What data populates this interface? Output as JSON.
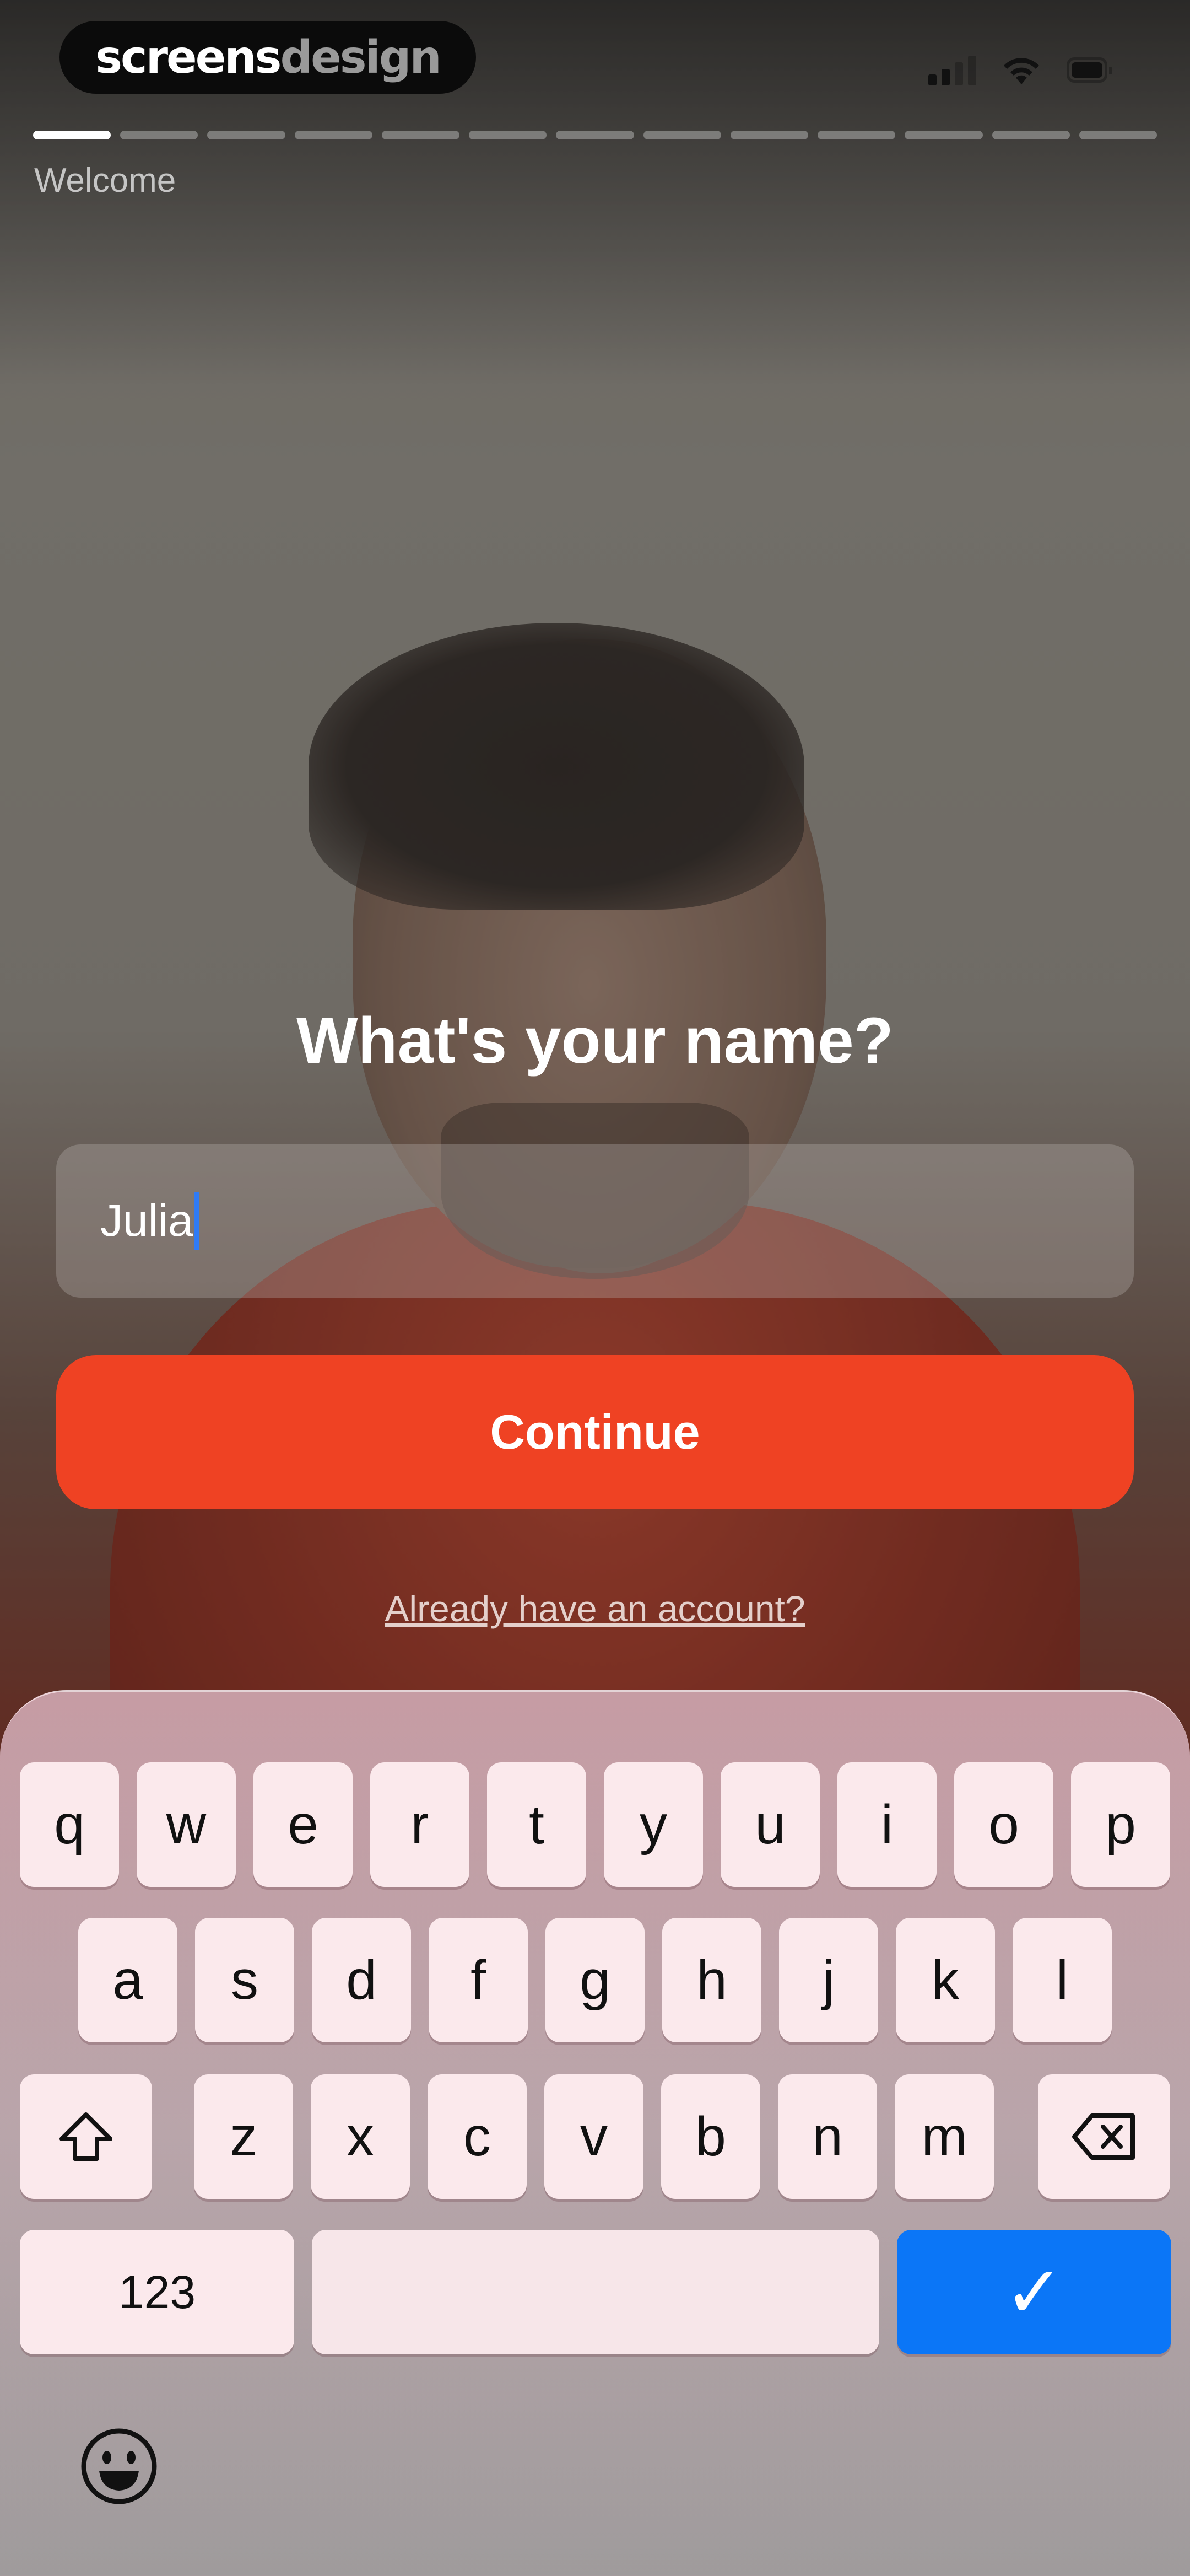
{
  "brand": {
    "part1": "screens",
    "part2": "design"
  },
  "onboarding": {
    "step_label": "Welcome",
    "total_steps": 13,
    "current_step": 1,
    "question": "What's your name?",
    "name_value": "Julia",
    "continue_label": "Continue",
    "account_link": "Already have an account?"
  },
  "keyboard": {
    "row1": [
      "q",
      "w",
      "e",
      "r",
      "t",
      "y",
      "u",
      "i",
      "o",
      "p"
    ],
    "row2": [
      "a",
      "s",
      "d",
      "f",
      "g",
      "h",
      "j",
      "k",
      "l"
    ],
    "row3": [
      "z",
      "x",
      "c",
      "v",
      "b",
      "n",
      "m"
    ],
    "numbers_label": "123",
    "confirm_glyph": "✓"
  },
  "icons": [
    "signal-icon",
    "wifi-icon",
    "battery-icon",
    "shift-icon",
    "backspace-icon",
    "emoji-icon"
  ],
  "colors": {
    "accent": "#ef4223",
    "confirm": "#0b76f7"
  }
}
